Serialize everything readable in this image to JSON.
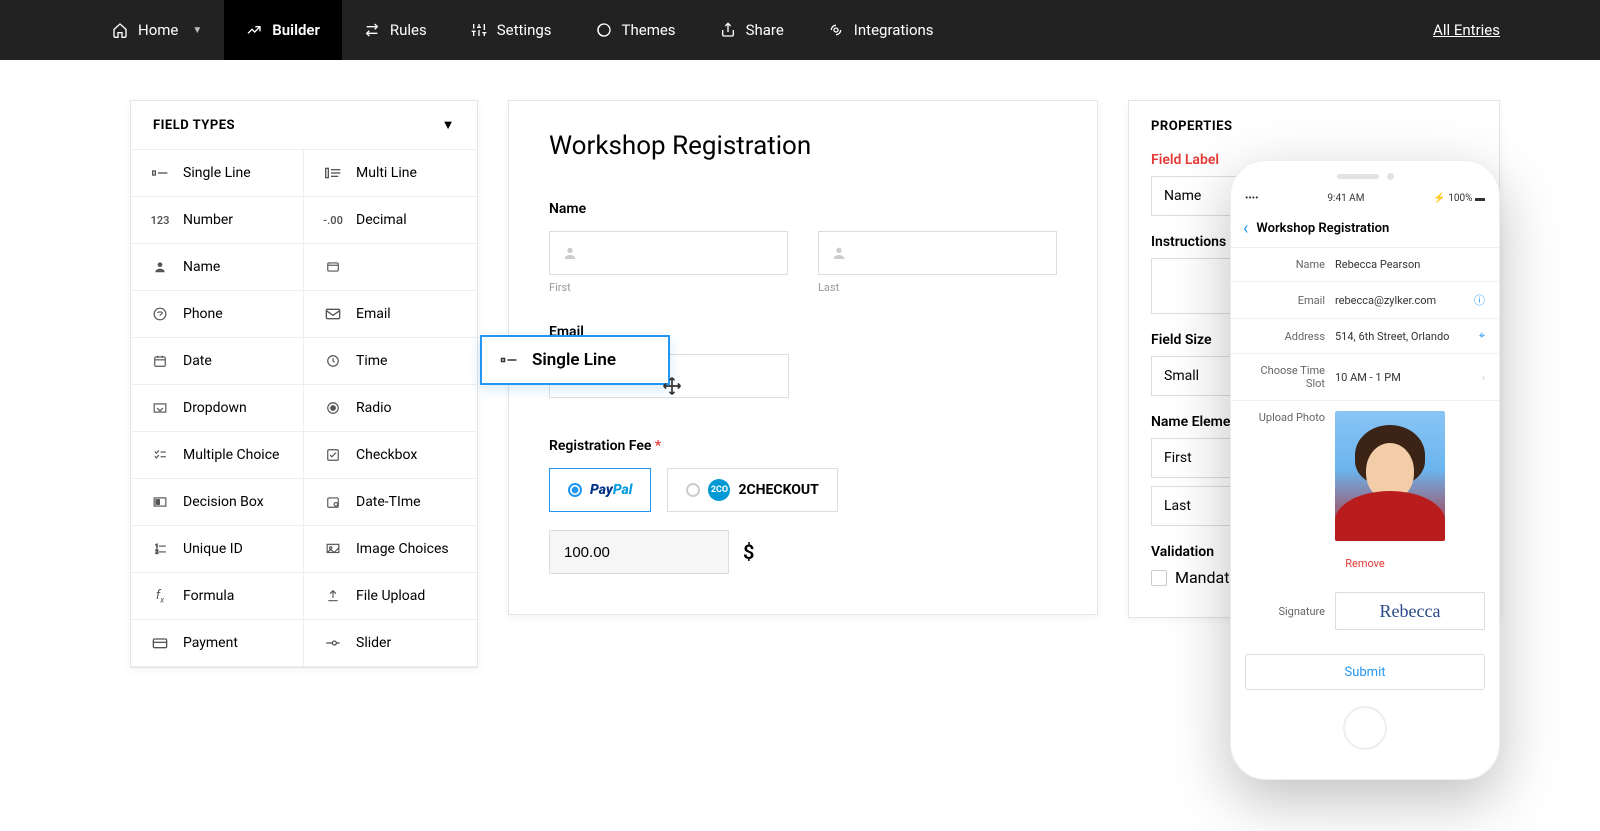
{
  "nav": {
    "items": [
      {
        "label": "Home",
        "has_chevron": true
      },
      {
        "label": "Builder"
      },
      {
        "label": "Rules"
      },
      {
        "label": "Settings"
      },
      {
        "label": "Themes"
      },
      {
        "label": "Share"
      },
      {
        "label": "Integrations"
      }
    ],
    "active_index": 1,
    "all_entries": "All Entries"
  },
  "field_types": {
    "header": "FIELD TYPES",
    "items": [
      "Single Line",
      "Multi Line",
      "Number",
      "Decimal",
      "Name",
      "",
      "Phone",
      "Email",
      "Date",
      "Time",
      "Dropdown",
      "Radio",
      "Multiple Choice",
      "Checkbox",
      "Decision Box",
      "Date-TIme",
      "Unique ID",
      "Image Choices",
      "Formula",
      "File Upload",
      "Payment",
      "Slider"
    ]
  },
  "drag": {
    "label": "Single Line"
  },
  "form": {
    "title": "Workshop Registration",
    "name_label": "Name",
    "first_sub": "First",
    "last_sub": "Last",
    "email_label": "Email",
    "fee_label": "Registration Fee",
    "paypal": "PayPal",
    "twocheckout": "2CHECKOUT",
    "fee_value": "100.00",
    "currency": "$"
  },
  "props": {
    "title": "PROPERTIES",
    "field_label": "Field Label",
    "field_label_value": "Name",
    "instructions": "Instructions",
    "field_size": "Field  Size",
    "field_size_value": "Small",
    "name_elements": "Name Elements",
    "first": "First",
    "last": "Last",
    "validation": "Validation",
    "mandatory": "Mandatory"
  },
  "phone": {
    "status_time": "9:41 AM",
    "status_battery": "100%",
    "title": "Workshop Registration",
    "fields": {
      "name_label": "Name",
      "name_val": "Rebecca Pearson",
      "email_label": "Email",
      "email_val": "rebecca@zylker.com",
      "address_label": "Address",
      "address_val": "514, 6th Street, Orlando",
      "slot_label": "Choose Time Slot",
      "slot_val": "10 AM - 1 PM",
      "photo_label": "Upload Photo",
      "remove": "Remove",
      "sig_label": "Signature",
      "sig_val": "Rebecca",
      "submit": "Submit"
    }
  }
}
